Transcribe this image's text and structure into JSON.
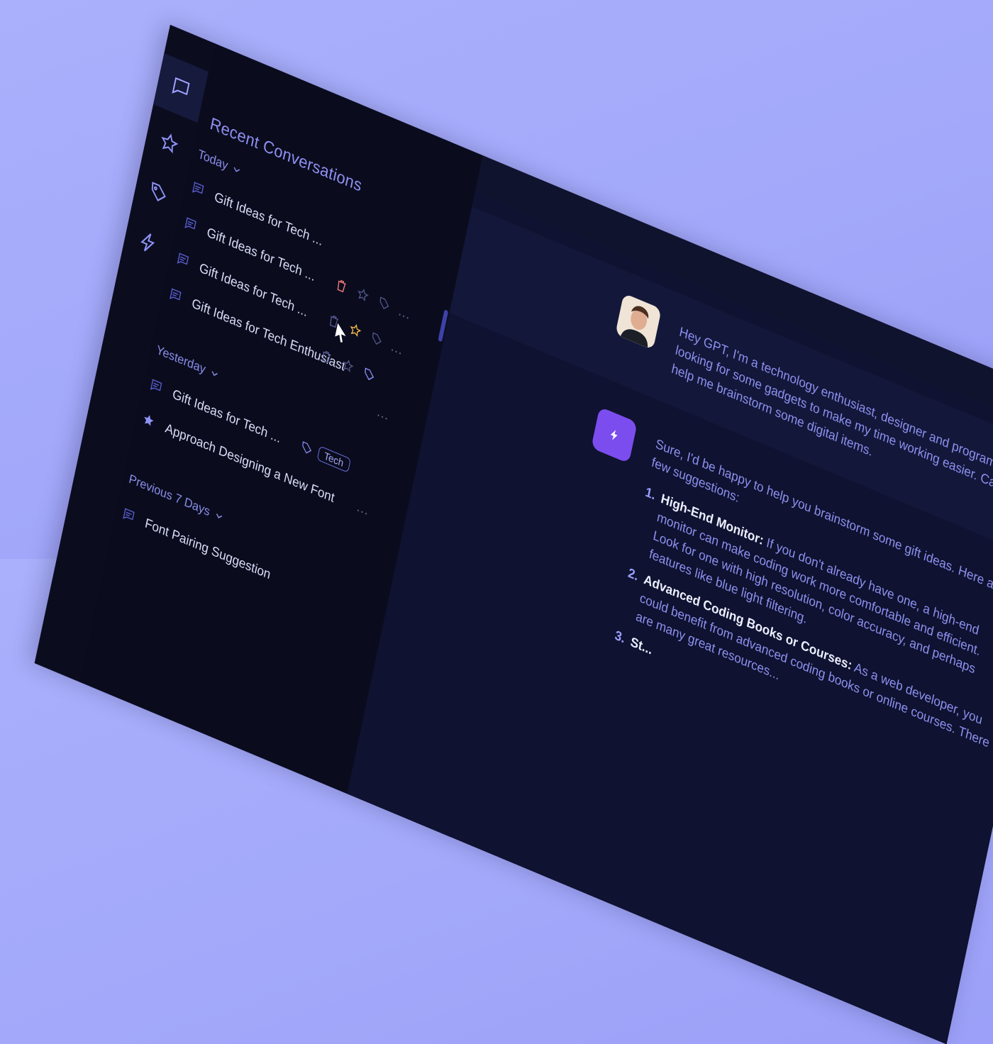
{
  "panel": {
    "title": "Recent Conversations"
  },
  "groups": {
    "today": "Today",
    "yesterday": "Yesterday",
    "previous": "Previous 7 Days"
  },
  "conversations": [
    {
      "title": "Gift Ideas for Tech ...",
      "group": "today"
    },
    {
      "title": "Gift Ideas for Tech ...",
      "group": "today",
      "hover_delete": true
    },
    {
      "title": "Gift Ideas for Tech ...",
      "group": "today",
      "starred": true
    },
    {
      "title": "Gift Ideas for Tech Enthusiast",
      "group": "today",
      "tagged": true
    },
    {
      "title": "Gift Ideas for Tech ...",
      "group": "yesterday",
      "tag": "Tech"
    },
    {
      "title": "Approach Designing a New Font",
      "group": "yesterday",
      "pinned": true
    },
    {
      "title": "Font Pairing Suggestion",
      "group": "previous"
    }
  ],
  "more_label": "...",
  "chat": {
    "user_message": "Hey GPT, I'm a technology enthusiast, designer and programmer. I'm looking for some gadgets to make my time working easier. Can you help me brainstorm some digital items.",
    "bot_intro": "Sure, I'd be happy to help you brainstorm some gift ideas. Here are a few suggestions:",
    "suggestions": [
      {
        "num": "1.",
        "title": "High-End Monitor:",
        "text": "If you don't already have one, a high-end monitor can make coding work more comfortable and efficient. Look for one with high resolution, color accuracy, and perhaps features like blue light filtering."
      },
      {
        "num": "2.",
        "title": "Advanced Coding Books or Courses:",
        "text": "As a web developer, you could benefit from advanced coding books or online courses. There are many great resources..."
      },
      {
        "num": "3.",
        "title": "St...",
        "text": ""
      }
    ]
  },
  "colors": {
    "accent": "#7b4dee",
    "delete_hover": "#f47a7a",
    "star": "#f2b84b",
    "tag": "#6a6ddc"
  },
  "icons": [
    "chat-bubble-icon",
    "star-icon",
    "tags-icon",
    "bolt-icon",
    "message-icon",
    "trash-icon",
    "tag-icon",
    "chevron-down-icon",
    "cursor-arrow-icon"
  ]
}
